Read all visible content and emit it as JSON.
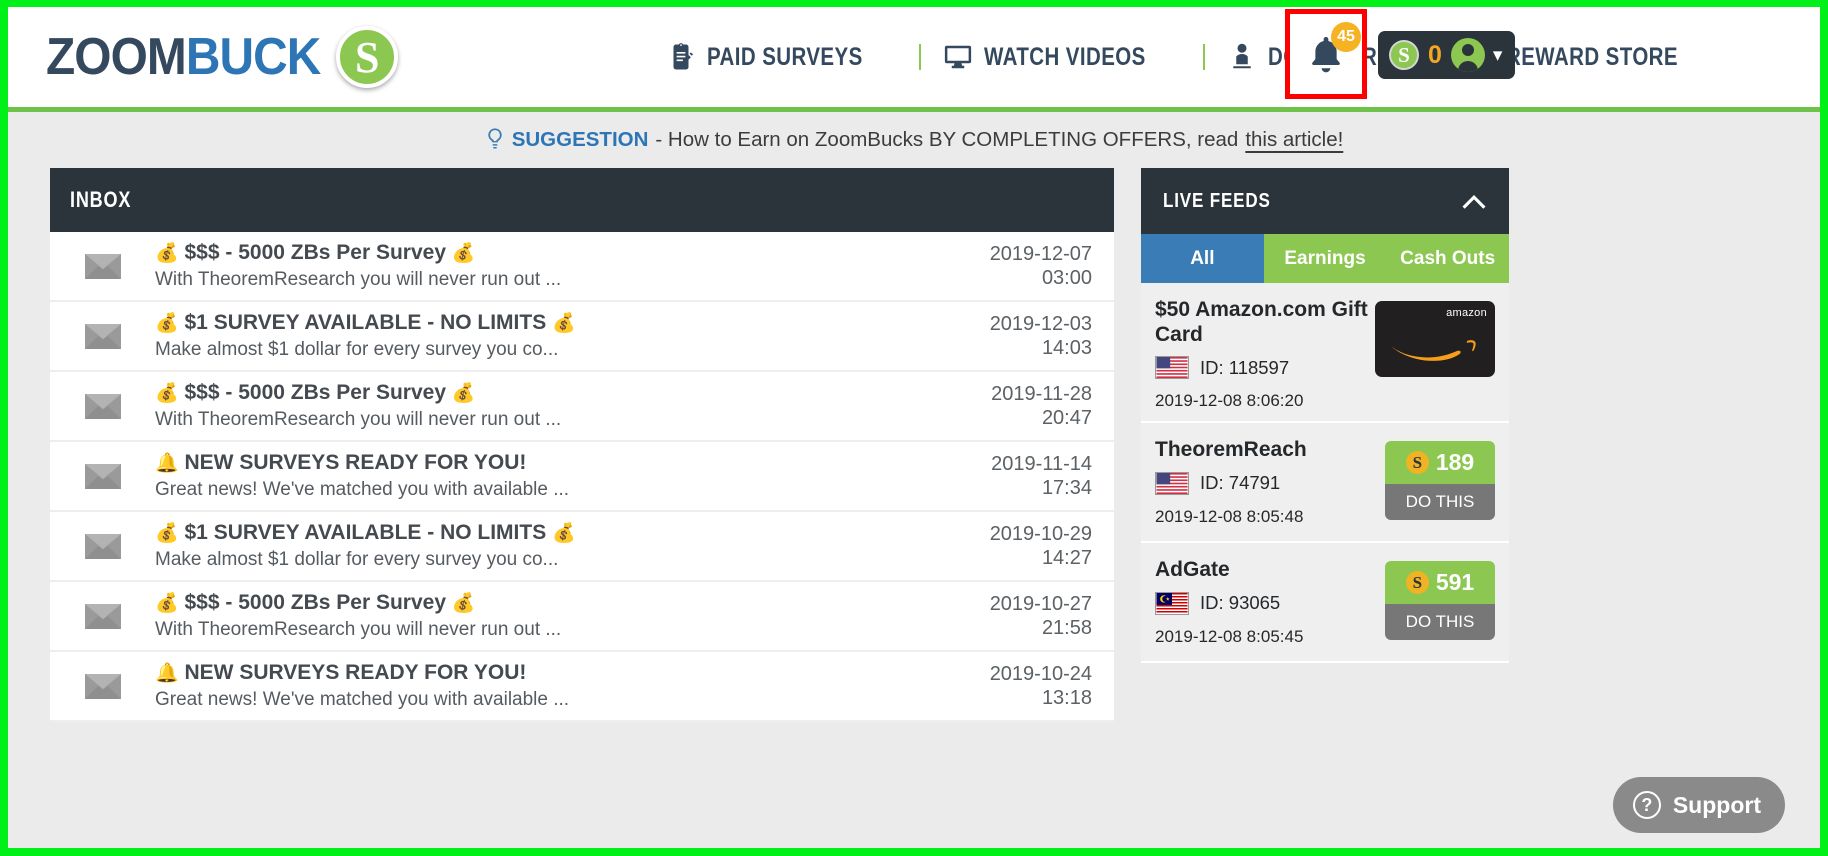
{
  "brand": {
    "logo_part1": "ZOOM",
    "logo_part2": "BUCK",
    "logo_coin_symbol": "S",
    "accent_green": "#8cc751",
    "dark_navy": "#34495e",
    "frame_green": "#00f018",
    "highlight_red": "#fe0000"
  },
  "nav": {
    "items": [
      {
        "label": "PAID SURVEYS",
        "icon": "clipboard-pencil-icon"
      },
      {
        "label": "WATCH VIDEOS",
        "icon": "monitor-icon"
      },
      {
        "label": "DO OFFERS",
        "icon": "person-laptop-icon"
      },
      {
        "label": "REWARD STORE",
        "icon": "gift-icon"
      }
    ]
  },
  "notifications": {
    "icon": "bell-icon",
    "badge_count": "45"
  },
  "user": {
    "coin_symbol": "S",
    "balance": "0",
    "avatar_icon": "user-avatar-icon",
    "chevron": "chevron-down-icon"
  },
  "suggestion": {
    "icon": "lightbulb-icon",
    "label": "SUGGESTION",
    "text": "- How to Earn on ZoomBucks BY COMPLETING OFFERS, read",
    "link": "this article!"
  },
  "inbox": {
    "title": "INBOX",
    "messages": [
      {
        "icon": "envelope-icon",
        "emoji_left": "💰",
        "subject": "$$$ - 5000 ZBs Per Survey",
        "emoji_right": "💰",
        "preview": "With TheoremResearch you will never run out ...",
        "date": "2019-12-07",
        "time": "03:00"
      },
      {
        "icon": "envelope-icon",
        "emoji_left": "💰",
        "subject": "$1 SURVEY AVAILABLE - NO LIMITS",
        "emoji_right": "💰",
        "preview": "Make almost $1 dollar for every survey you co...",
        "date": "2019-12-03",
        "time": "14:03"
      },
      {
        "icon": "envelope-icon",
        "emoji_left": "💰",
        "subject": "$$$ - 5000 ZBs Per Survey",
        "emoji_right": "💰",
        "preview": "With TheoremResearch you will never run out ...",
        "date": "2019-11-28",
        "time": "20:47"
      },
      {
        "icon": "envelope-icon",
        "emoji_left": "🔔",
        "subject": "NEW SURVEYS READY FOR YOU!",
        "emoji_right": "",
        "preview": "Great news! We've matched you with available ...",
        "date": "2019-11-14",
        "time": "17:34"
      },
      {
        "icon": "envelope-icon",
        "emoji_left": "💰",
        "subject": "$1 SURVEY AVAILABLE - NO LIMITS",
        "emoji_right": "💰",
        "preview": "Make almost $1 dollar for every survey you co...",
        "date": "2019-10-29",
        "time": "14:27"
      },
      {
        "icon": "envelope-icon",
        "emoji_left": "💰",
        "subject": "$$$ - 5000 ZBs Per Survey",
        "emoji_right": "💰",
        "preview": "With TheoremResearch you will never run out ...",
        "date": "2019-10-27",
        "time": "21:58"
      },
      {
        "icon": "envelope-icon",
        "emoji_left": "🔔",
        "subject": "NEW SURVEYS READY FOR YOU!",
        "emoji_right": "",
        "preview": "Great news! We've matched you with available ...",
        "date": "2019-10-24",
        "time": "13:18"
      }
    ]
  },
  "live_feeds": {
    "title": "LIVE FEEDS",
    "collapse_icon": "chevron-up-icon",
    "tabs": [
      {
        "label": "All",
        "active": true
      },
      {
        "label": "Earnings",
        "active": false
      },
      {
        "label": "Cash Outs",
        "active": false
      }
    ],
    "items": [
      {
        "title": "$50 Amazon.com Gift Card",
        "flag": "us-flag-icon",
        "id_label": "ID: 118597",
        "timestamp": "2019-12-08 8:06:20",
        "card_brand": "amazon",
        "type": "giftcard"
      },
      {
        "title": "TheoremReach",
        "flag": "us-flag-icon",
        "id_label": "ID: 74791",
        "timestamp": "2019-12-08 8:05:48",
        "reward_value": "189",
        "reward_action": "DO THIS",
        "type": "reward"
      },
      {
        "title": "AdGate",
        "flag": "my-flag-icon",
        "id_label": "ID: 93065",
        "timestamp": "2019-12-08 8:05:45",
        "reward_value": "591",
        "reward_action": "DO THIS",
        "type": "reward"
      }
    ]
  },
  "support": {
    "icon": "question-circle-icon",
    "label": "Support"
  }
}
